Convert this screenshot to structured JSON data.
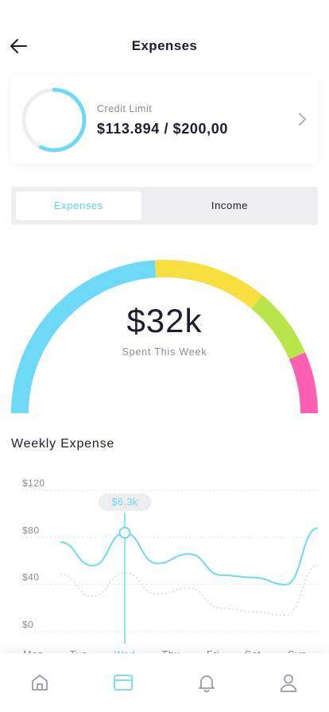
{
  "header": {
    "title": "Expenses",
    "back_icon": "arrow-left-icon"
  },
  "credit": {
    "label": "Credit Limit",
    "value": "$113.894 / $200,00",
    "progress": 0.57,
    "ring_color": "#6ed8f7",
    "track_color": "#eeeeee"
  },
  "segmented": {
    "tabs": [
      {
        "label": "Expenses",
        "active": true
      },
      {
        "label": "Income",
        "active": false
      }
    ]
  },
  "gauge": {
    "value": "$32k",
    "label": "Spent This Week",
    "segments": [
      {
        "color": "#6ed8f7",
        "fraction": 0.48
      },
      {
        "color": "#f9de3f",
        "fraction": 0.24
      },
      {
        "color": "#b9e54a",
        "fraction": 0.15
      },
      {
        "color": "#ff5fb0",
        "fraction": 0.13
      }
    ]
  },
  "weekly": {
    "title": "Weekly Expense"
  },
  "chart_data": {
    "type": "line",
    "y_ticks": [
      "$120",
      "$80",
      "$40",
      "$0"
    ],
    "ylim": [
      0,
      120
    ],
    "categories": [
      "Mon",
      "Tue",
      "Wed",
      "Thu",
      "Fri",
      "Sat",
      "Sun"
    ],
    "selected_category": "Wed",
    "tooltip": "$6.3k",
    "series": [
      {
        "values": [
          76,
          56,
          84,
          58,
          66,
          48,
          46,
          40,
          88
        ],
        "color": "#6ed8f7",
        "style": "solid"
      },
      {
        "values": [
          49,
          30,
          50,
          32,
          37,
          20,
          17,
          14,
          56
        ],
        "color": "#d7d7dc",
        "style": "dotted"
      }
    ],
    "grid": true
  },
  "tabbar": {
    "items": [
      {
        "icon": "home-icon",
        "active": false
      },
      {
        "icon": "wallet-icon",
        "active": true
      },
      {
        "icon": "bell-icon",
        "active": false
      },
      {
        "icon": "profile-icon",
        "active": false
      }
    ]
  }
}
